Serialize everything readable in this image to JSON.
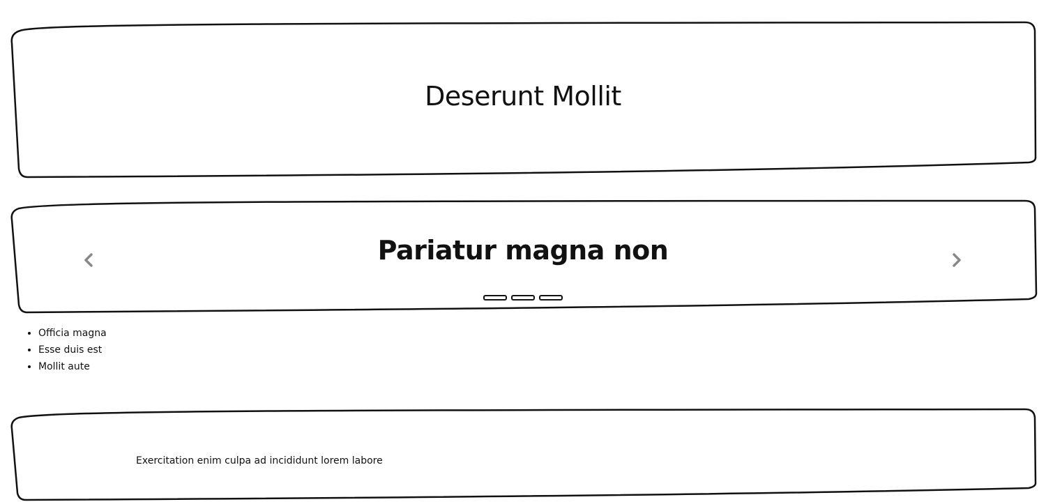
{
  "header": {
    "title": "Deserunt Mollit"
  },
  "carousel": {
    "title": "Pariatur magna non",
    "prev_icon": "chevron-left-icon",
    "next_icon": "chevron-right-icon",
    "indicator_count": 3,
    "active_index": 0
  },
  "list": {
    "items": [
      "Officia magna",
      "Esse duis est",
      "Mollit aute"
    ]
  },
  "footer": {
    "text": "Exercitation enim culpa ad incididunt lorem labore"
  },
  "colors": {
    "border": "#111111",
    "arrow": "#888888",
    "background": "#ffffff"
  }
}
